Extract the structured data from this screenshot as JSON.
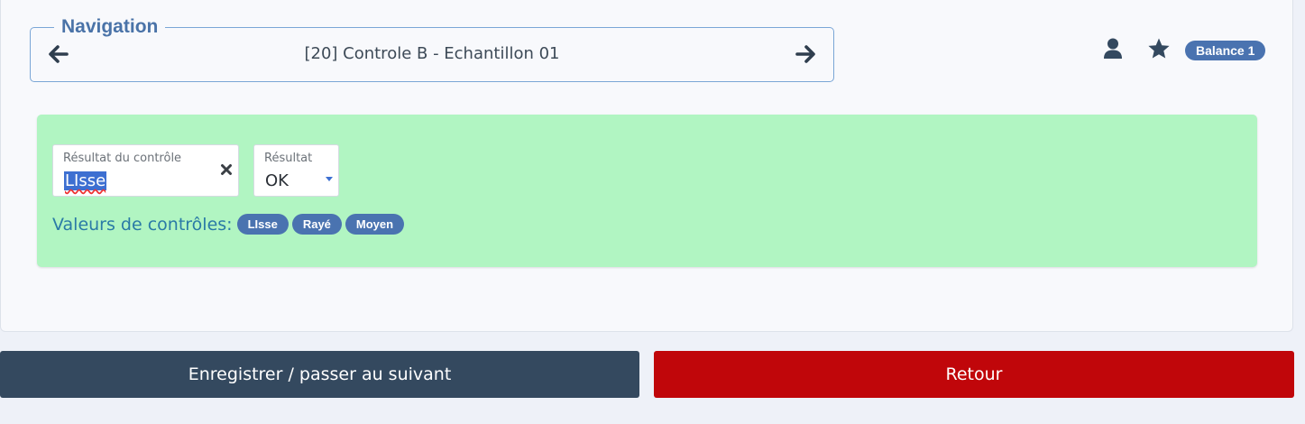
{
  "navigation": {
    "legend": "Navigation",
    "title": "[20] Controle B - Echantillon 01",
    "prev_icon": "arrow-left-icon",
    "next_icon": "arrow-right-icon"
  },
  "header": {
    "user_icon": "user-icon",
    "star_icon": "star-icon",
    "balance_badge": "Balance 1"
  },
  "control": {
    "panel_color": "#b1f5c2",
    "result_field": {
      "label": "Résultat du contrôle",
      "value": "LIsse",
      "clear_icon": "close-icon"
    },
    "status_field": {
      "label": "Résultat",
      "value": "OK",
      "caret_icon": "caret-down-icon"
    },
    "values_label": "Valeurs de contrôles:",
    "values": [
      "LIsse",
      "Rayé",
      "Moyen"
    ]
  },
  "actions": {
    "save_label": "Enregistrer / passer au suivant",
    "back_label": "Retour",
    "save_color": "#34495f",
    "back_color": "#c0060a"
  }
}
